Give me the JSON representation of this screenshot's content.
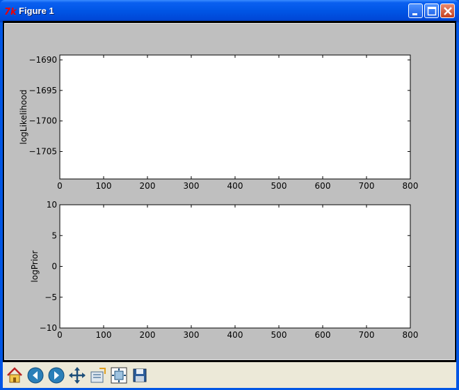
{
  "window": {
    "title": "Figure 1"
  },
  "chart_data": [
    {
      "type": "line",
      "title": "",
      "xlabel": "",
      "ylabel": "logLikelihood",
      "xlim": [
        0,
        800
      ],
      "ylim": [
        -1709.5,
        -1689.2
      ],
      "x_ticks": [
        "0",
        "100",
        "200",
        "300",
        "400",
        "500",
        "600",
        "700",
        "800"
      ],
      "y_ticks": [
        "−1690",
        "−1695",
        "−1700",
        "−1705"
      ],
      "series": [],
      "grid": false
    },
    {
      "type": "line",
      "title": "",
      "xlabel": "",
      "ylabel": "logPrior",
      "xlim": [
        0,
        800
      ],
      "ylim": [
        -10,
        10
      ],
      "x_ticks": [
        "0",
        "100",
        "200",
        "300",
        "400",
        "500",
        "600",
        "700",
        "800"
      ],
      "y_ticks": [
        "10",
        "5",
        "0",
        "−5",
        "−10"
      ],
      "series": [],
      "grid": false
    }
  ],
  "toolbar": {
    "tools": [
      {
        "icon": "home-icon",
        "name": "home-button"
      },
      {
        "icon": "back-arrow-icon",
        "name": "back-button"
      },
      {
        "icon": "forward-arrow-icon",
        "name": "forward-button"
      },
      {
        "icon": "pan-move-icon",
        "name": "pan-button"
      },
      {
        "icon": "zoom-rectangle-icon",
        "name": "zoom-button"
      },
      {
        "icon": "configure-subplots-icon",
        "name": "subplots-button"
      },
      {
        "icon": "save-floppy-icon",
        "name": "save-button"
      }
    ]
  }
}
